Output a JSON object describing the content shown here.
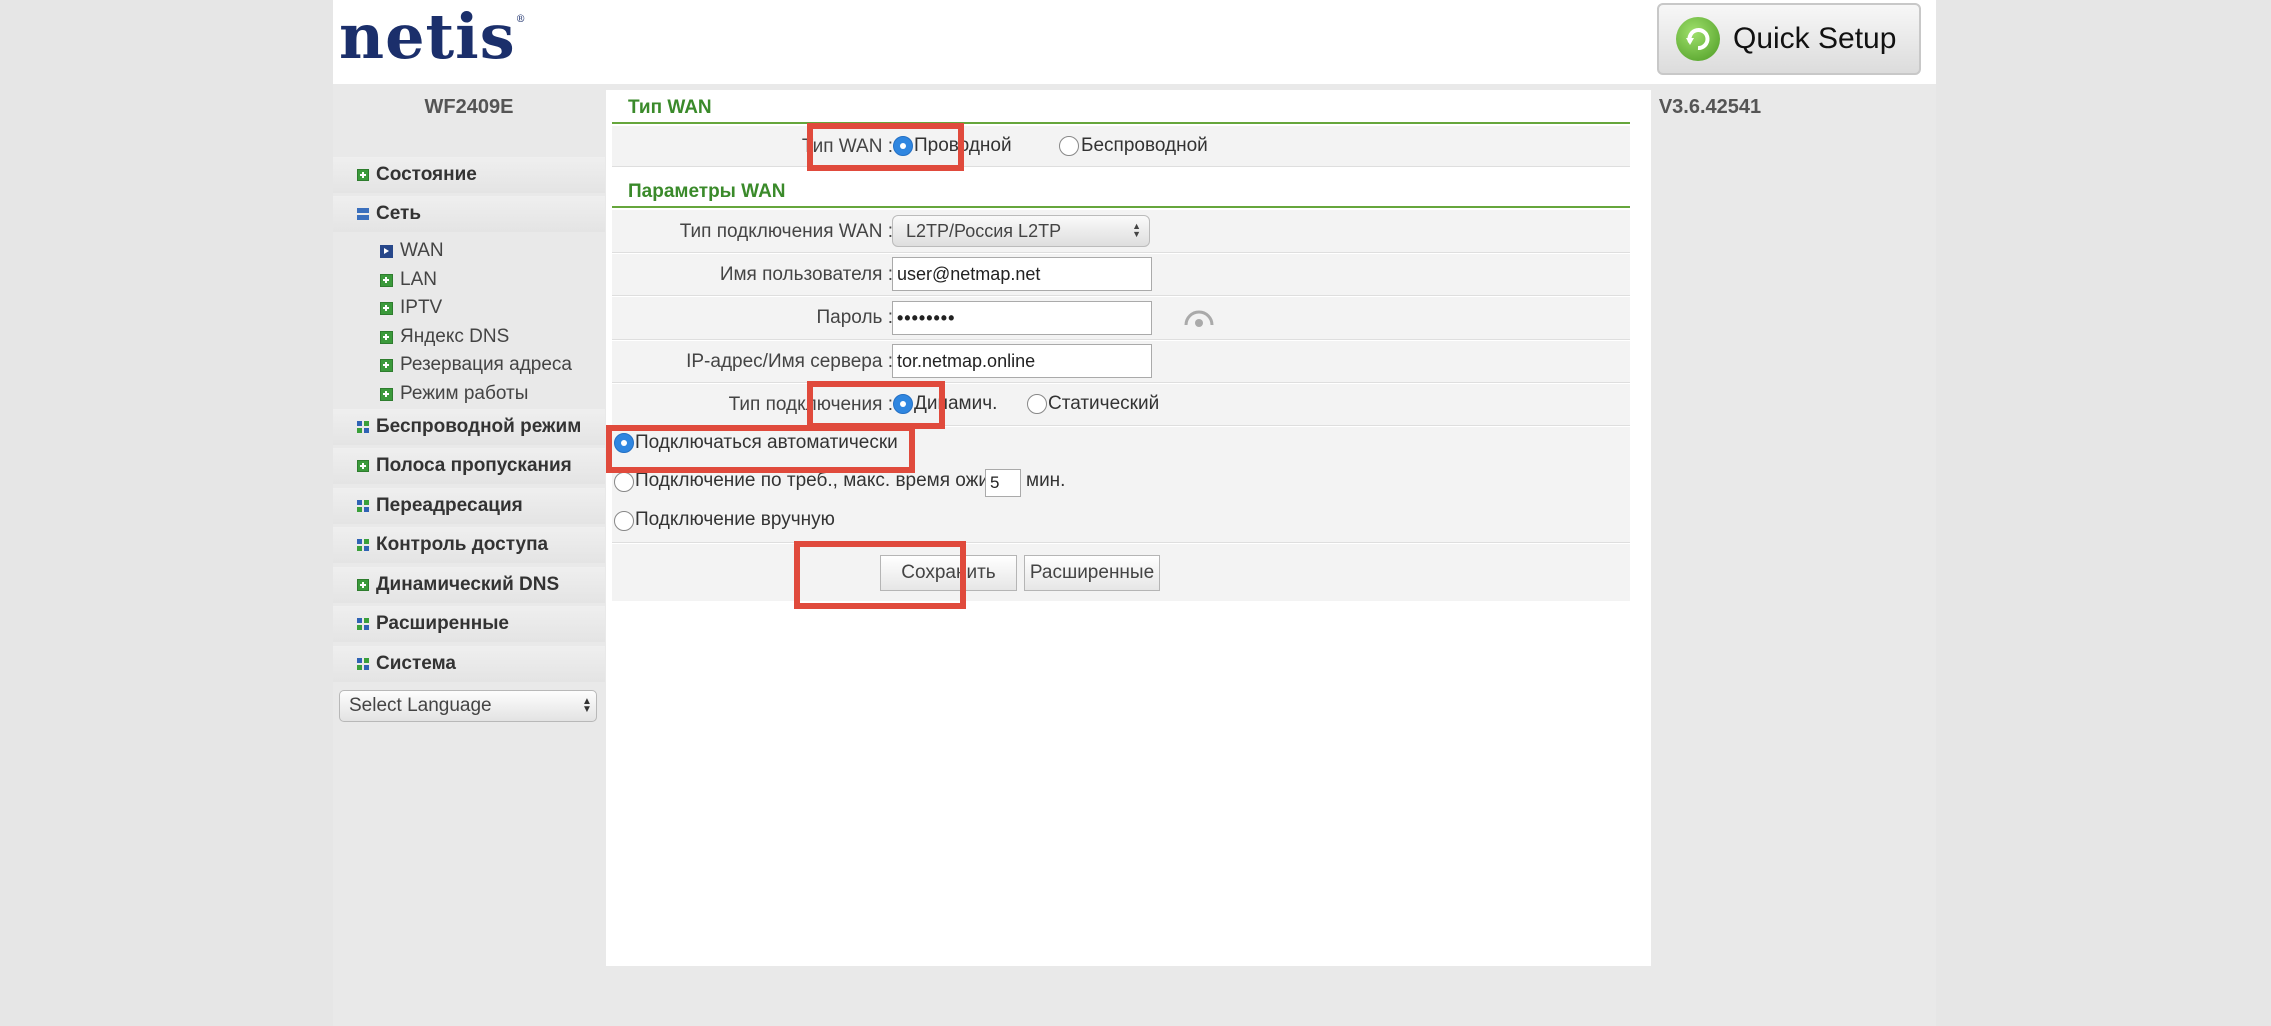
{
  "header": {
    "logo": "netis",
    "logo_mark": "®",
    "quick_setup_label": "Quick Setup",
    "quick_setup_icon": "refresh-arrow-icon"
  },
  "sidebar": {
    "model": "WF2409E",
    "items": [
      {
        "label": "Состояние",
        "icon": "plus-icon"
      },
      {
        "label": "Сеть",
        "icon": "minus-icon"
      },
      {
        "label": "Беспроводной режим",
        "icon": "grid-icon"
      },
      {
        "label": "Полоса пропускания",
        "icon": "plus-icon"
      },
      {
        "label": "Переадресация",
        "icon": "grid-icon"
      },
      {
        "label": "Контроль доступа",
        "icon": "grid-icon"
      },
      {
        "label": "Динамический DNS",
        "icon": "plus-icon"
      },
      {
        "label": "Расширенные",
        "icon": "grid-icon"
      },
      {
        "label": "Система",
        "icon": "grid-icon"
      }
    ],
    "subitems": [
      {
        "label": "WAN",
        "icon": "arrow-icon"
      },
      {
        "label": "LAN",
        "icon": "plus-icon"
      },
      {
        "label": "IPTV",
        "icon": "plus-icon"
      },
      {
        "label": "Яндекс DNS",
        "icon": "plus-icon"
      },
      {
        "label": "Резервация адреса",
        "icon": "plus-icon"
      },
      {
        "label": "Режим работы",
        "icon": "plus-icon"
      }
    ],
    "language_select": "Select Language"
  },
  "version": "V3.6.42541",
  "main": {
    "wan_type_title": "Тип WAN",
    "wan_type_label": "Тип WAN :",
    "wan_type_options": [
      "Проводной",
      "Беспроводной"
    ],
    "wan_params_title": "Параметры WAN",
    "connection_type_label": "Тип подключения WAN :",
    "connection_type_value": "L2TP/Россия L2TP",
    "username_label": "Имя пользователя :",
    "username_value": "user@netmap.net",
    "password_label": "Пароль :",
    "password_value": "••••••••",
    "server_label": "IP-адрес/Имя сервера :",
    "server_value": "tor.netmap.online",
    "addr_type_label": "Тип подключения :",
    "addr_type_options": [
      "Динамич.",
      "Статический"
    ],
    "connect_auto": "Подключаться автоматически",
    "connect_on_demand": "Подключение по треб., макс. время ожид.",
    "idle_time_value": "5",
    "idle_time_unit": "мин.",
    "connect_manual": "Подключение вручную",
    "save_label": "Сохранить",
    "advanced_label": "Расширенные"
  },
  "colors": {
    "accent_green": "#3a8a2a",
    "highlight_red": "#e04a3c",
    "radio_blue": "#2f86e0",
    "logo_navy": "#1b2f6b"
  }
}
